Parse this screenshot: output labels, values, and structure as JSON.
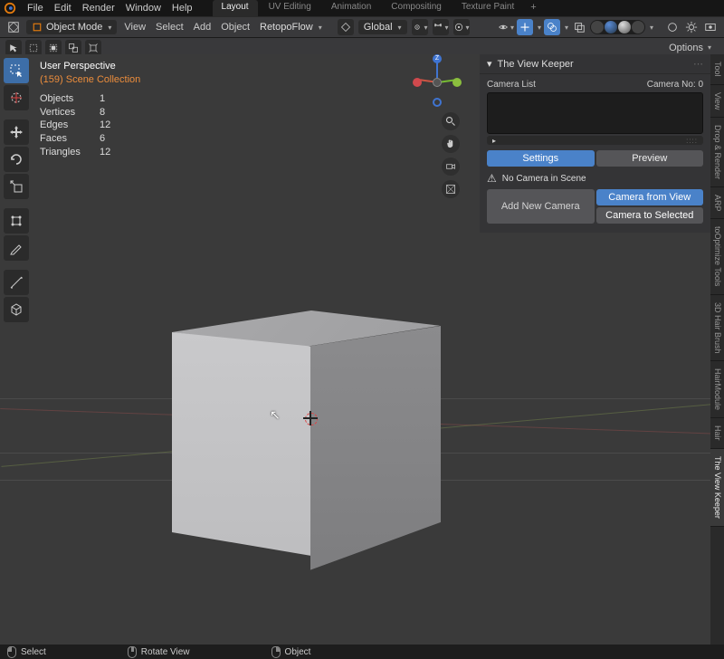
{
  "top_menu": {
    "file": "File",
    "edit": "Edit",
    "render": "Render",
    "window": "Window",
    "help": "Help"
  },
  "workspaces": {
    "layout": "Layout",
    "uv": "UV Editing",
    "anim": "Animation",
    "comp": "Compositing",
    "texpaint": "Texture Paint"
  },
  "header": {
    "mode": "Object Mode",
    "view": "View",
    "select": "Select",
    "add": "Add",
    "object": "Object",
    "retopo": "RetopoFlow",
    "orientation": "Global",
    "options": "Options"
  },
  "overlay": {
    "title": "User Perspective",
    "subtitle": "(159) Scene Collection",
    "stats": {
      "objects_l": "Objects",
      "objects_v": "1",
      "verts_l": "Vertices",
      "verts_v": "8",
      "edges_l": "Edges",
      "edges_v": "12",
      "faces_l": "Faces",
      "faces_v": "6",
      "tris_l": "Triangles",
      "tris_v": "12"
    }
  },
  "gizmo": {
    "z": "Z"
  },
  "panel": {
    "title": "The View Keeper",
    "cam_list_label": "Camera List",
    "cam_no_label": "Camera No:",
    "cam_no_val": "0",
    "settings": "Settings",
    "preview": "Preview",
    "warn": "No Camera in Scene",
    "add_new": "Add New Camera",
    "from_view": "Camera from View",
    "to_selected": "Camera to Selected"
  },
  "right_tabs": {
    "tool": "Tool",
    "view": "View",
    "drop": "Drop & Render",
    "arp": "ARP",
    "tooptim": "toOptimize Tools",
    "hairbrush": "3D Hair Brush",
    "hairmod": "HairModule",
    "hair": "Hair",
    "viewkeeper": "The View Keeper"
  },
  "status": {
    "select": "Select",
    "rotate": "Rotate View",
    "object": "Object"
  }
}
